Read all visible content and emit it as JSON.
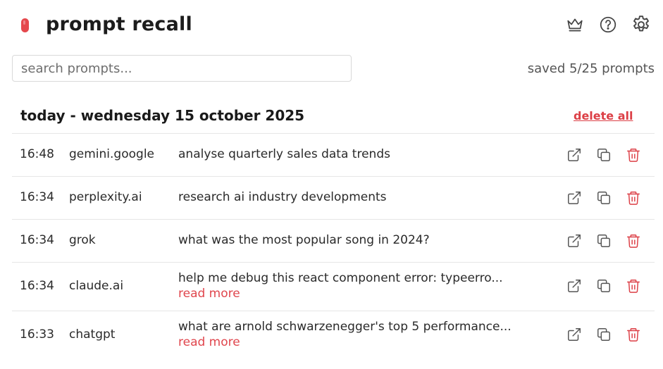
{
  "app": {
    "title": "prompt recall"
  },
  "header_icons": {
    "crown": "crown-icon",
    "help": "help-circle-icon",
    "settings": "gear-icon"
  },
  "search": {
    "placeholder": "search prompts...",
    "value": ""
  },
  "saved_count": "saved 5/25 prompts",
  "group": {
    "title": "today - wednesday 15 october 2025",
    "delete_all_label": "delete all"
  },
  "colors": {
    "accent": "#dc3f46",
    "text": "#1f1f1f",
    "border": "#e6e6e6"
  },
  "prompts": [
    {
      "time": "16:48",
      "site": "gemini.google",
      "text": "analyse quarterly sales data trends",
      "read_more": ""
    },
    {
      "time": "16:34",
      "site": "perplexity.ai",
      "text": "research ai industry developments",
      "read_more": ""
    },
    {
      "time": "16:34",
      "site": "grok",
      "text": "what was the most popular song in 2024?",
      "read_more": ""
    },
    {
      "time": "16:34",
      "site": "claude.ai",
      "text": "help me debug this react component error: typeerro...",
      "read_more": "read more"
    },
    {
      "time": "16:33",
      "site": "chatgpt",
      "text": "what are arnold schwarzenegger's top 5 performance...",
      "read_more": "read more"
    }
  ]
}
